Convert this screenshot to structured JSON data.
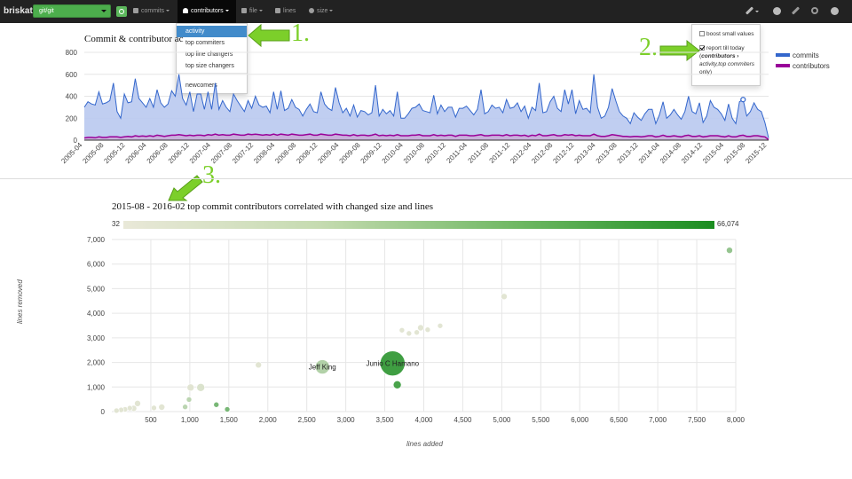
{
  "navbar": {
    "brand": "briskat",
    "repo": "git/git",
    "menus": [
      {
        "label": "commits",
        "icon": "bar-chart-icon"
      },
      {
        "label": "contributors",
        "icon": "user-icon"
      },
      {
        "label": "file",
        "icon": "file-icon"
      },
      {
        "label": "lines",
        "icon": "lines-icon"
      },
      {
        "label": "size",
        "icon": "size-icon"
      }
    ],
    "right_icons": [
      "wrench-icon",
      "plus-circle-icon",
      "pencil-icon",
      "link-icon",
      "help-icon"
    ]
  },
  "contributors_menu": {
    "items": [
      "activity",
      "top commiters",
      "top line changers",
      "top size changers"
    ],
    "extra_item": "newcomers",
    "active_index": 0
  },
  "options_panel": {
    "boost_label": "boost small values",
    "boost_checked": false,
    "report_label_1": "report till today",
    "report_paren_open": "(",
    "report_bold": "contributors",
    "report_arrow": " ›",
    "report_italic": "activity,top commiters",
    "report_paren_close": "only)",
    "report_checked": true
  },
  "annotations": [
    "1.",
    "2.",
    "3."
  ],
  "colors": {
    "accent_green": "#7ccf2a",
    "commits_line": "#3366cc",
    "commits_fill": "#b9c9ef",
    "contributors_line": "#990099",
    "bubble_dark": "#1a8d20",
    "bubble_light": "#e9e8d8"
  },
  "chart_data": [
    {
      "type": "area",
      "title": "Commit & contributor ac",
      "ylim": [
        0,
        800
      ],
      "yticks": [
        "800",
        "600",
        "400",
        "200",
        "0"
      ],
      "x_ticks": [
        "2005-04",
        "2005-08",
        "2005-12",
        "2006-04",
        "2006-08",
        "2006-12",
        "2007-04",
        "2007-08",
        "2007-12",
        "2008-04",
        "2008-08",
        "2008-12",
        "2009-04",
        "2009-08",
        "2009-12",
        "2010-04",
        "2010-08",
        "2010-12",
        "2011-04",
        "2011-08",
        "2011-12",
        "2012-04",
        "2012-08",
        "2012-12",
        "2013-04",
        "2013-08",
        "2013-12",
        "2014-04",
        "2014-08",
        "2014-12",
        "2015-04",
        "2015-08",
        "2015-12"
      ],
      "series": [
        {
          "name": "commits",
          "values": [
            300,
            350,
            330,
            320,
            440,
            330,
            340,
            360,
            520,
            260,
            200,
            420,
            340,
            350,
            560,
            380,
            340,
            300,
            380,
            300,
            460,
            340,
            300,
            330,
            450,
            400,
            600,
            380,
            320,
            440,
            260,
            420,
            420,
            280,
            440,
            280,
            520,
            280,
            360,
            300,
            260,
            420,
            360,
            310,
            260,
            360,
            290,
            400,
            320,
            300,
            310,
            250,
            440,
            280,
            450,
            270,
            290,
            370,
            300,
            280,
            220,
            280,
            330,
            260,
            250,
            440,
            330,
            290,
            270,
            480,
            340,
            250,
            290,
            220,
            320,
            210,
            270,
            260,
            230,
            250,
            500,
            220,
            280,
            240,
            270,
            220,
            440,
            200,
            200,
            240,
            290,
            300,
            330,
            270,
            260,
            250,
            410,
            240,
            320,
            260,
            300,
            300,
            210,
            290,
            290,
            310,
            270,
            230,
            280,
            460,
            240,
            260,
            320,
            290,
            300,
            250,
            370,
            290,
            300,
            340,
            260,
            310,
            200,
            300,
            270,
            520,
            250,
            260,
            350,
            400,
            290,
            260,
            460,
            330,
            460,
            240,
            360,
            280,
            290,
            250,
            600,
            300,
            200,
            220,
            300,
            470,
            360,
            260,
            220,
            200,
            150,
            250,
            210,
            180,
            240,
            280,
            280,
            150,
            230,
            350,
            200,
            230,
            280,
            230,
            190,
            260,
            400,
            260,
            240,
            340,
            160,
            220,
            360,
            300,
            280,
            240,
            180,
            330,
            200,
            150,
            350,
            370,
            220,
            260,
            340,
            280,
            260,
            160,
            20
          ]
        },
        {
          "name": "contributors",
          "values": [
            20,
            25,
            25,
            22,
            30,
            25,
            25,
            30,
            30,
            30,
            25,
            30,
            35,
            30,
            40,
            35,
            38,
            35,
            40,
            35,
            45,
            40,
            35,
            40,
            45,
            45,
            50,
            45,
            40,
            45,
            40,
            45,
            45,
            40,
            50,
            45,
            55,
            45,
            50,
            45,
            45,
            55,
            50,
            45,
            45,
            55,
            50,
            55,
            50,
            45,
            50,
            45,
            55,
            45,
            55,
            50,
            45,
            55,
            50,
            45,
            45,
            50,
            55,
            45,
            45,
            55,
            50,
            45,
            45,
            55,
            50,
            45,
            45,
            40,
            50,
            40,
            45,
            45,
            40,
            45,
            55,
            40,
            45,
            40,
            45,
            40,
            50,
            40,
            40,
            40,
            45,
            45,
            50,
            40,
            40,
            40,
            50,
            40,
            45,
            40,
            45,
            45,
            35,
            45,
            45,
            45,
            40,
            40,
            45,
            50,
            40,
            40,
            45,
            45,
            45,
            40,
            50,
            40,
            45,
            45,
            40,
            45,
            35,
            45,
            40,
            55,
            40,
            40,
            45,
            50,
            40,
            40,
            50,
            45,
            50,
            40,
            45,
            40,
            40,
            40,
            55,
            40,
            35,
            35,
            40,
            50,
            45,
            40,
            35,
            35,
            30,
            35,
            35,
            30,
            35,
            40,
            40,
            30,
            35,
            45,
            35,
            35,
            40,
            35,
            30,
            40,
            45,
            35,
            35,
            40,
            30,
            35,
            40,
            40,
            40,
            35,
            30,
            40,
            30,
            30,
            40,
            45,
            35,
            35,
            40,
            40,
            35,
            30,
            5
          ]
        }
      ],
      "markers": [
        {
          "series": "commits",
          "x_index": 181
        }
      ],
      "legend": [
        "commits",
        "contributors"
      ],
      "legend_position": "right"
    },
    {
      "type": "scatter",
      "title": "2015-08 - 2016-02 top commit contributors correlated with changed size and lines",
      "xlabel": "lines added",
      "ylabel": "lines removed",
      "xlim": [
        0,
        8000
      ],
      "ylim": [
        0,
        7000
      ],
      "xticks": [
        500,
        1000,
        1500,
        2000,
        2500,
        3000,
        3500,
        4000,
        4500,
        5000,
        5500,
        6000,
        6500,
        7000,
        7500,
        8000
      ],
      "yticks": [
        0,
        1000,
        2000,
        3000,
        4000,
        5000,
        6000,
        7000
      ],
      "colorbar": {
        "min": "32",
        "max": "66,074"
      },
      "points": [
        {
          "x": 7920,
          "y": 6560,
          "r": 3.5,
          "c": 0.45
        },
        {
          "x": 5030,
          "y": 4680,
          "r": 3.5,
          "c": 0.05
        },
        {
          "x": 4210,
          "y": 3490,
          "r": 3,
          "c": 0.05
        },
        {
          "x": 4050,
          "y": 3330,
          "r": 3,
          "c": 0.05
        },
        {
          "x": 3960,
          "y": 3410,
          "r": 3.5,
          "c": 0.05
        },
        {
          "x": 3910,
          "y": 3220,
          "r": 3,
          "c": 0.05
        },
        {
          "x": 3810,
          "y": 3180,
          "r": 3,
          "c": 0.05
        },
        {
          "x": 3720,
          "y": 3310,
          "r": 3,
          "c": 0.05
        },
        {
          "x": 3600,
          "y": 1960,
          "r": 14,
          "c": 0.9,
          "label": "Junio C Hamano"
        },
        {
          "x": 3660,
          "y": 1090,
          "r": 4.5,
          "c": 0.85
        },
        {
          "x": 2700,
          "y": 1820,
          "r": 8,
          "c": 0.3,
          "label": "Jeff King"
        },
        {
          "x": 1880,
          "y": 1900,
          "r": 3.5,
          "c": 0.05
        },
        {
          "x": 1480,
          "y": 90,
          "r": 3,
          "c": 0.6
        },
        {
          "x": 1340,
          "y": 280,
          "r": 3,
          "c": 0.6
        },
        {
          "x": 1140,
          "y": 980,
          "r": 4.5,
          "c": 0.08
        },
        {
          "x": 1010,
          "y": 980,
          "r": 4,
          "c": 0.05
        },
        {
          "x": 990,
          "y": 490,
          "r": 3,
          "c": 0.25
        },
        {
          "x": 940,
          "y": 190,
          "r": 3,
          "c": 0.25
        },
        {
          "x": 640,
          "y": 180,
          "r": 3.5,
          "c": 0.05
        },
        {
          "x": 540,
          "y": 150,
          "r": 3,
          "c": 0.05
        },
        {
          "x": 330,
          "y": 330,
          "r": 3.5,
          "c": 0.05
        },
        {
          "x": 280,
          "y": 130,
          "r": 3.5,
          "c": 0.05
        },
        {
          "x": 230,
          "y": 140,
          "r": 3,
          "c": 0.05
        },
        {
          "x": 170,
          "y": 90,
          "r": 3,
          "c": 0.05
        },
        {
          "x": 120,
          "y": 70,
          "r": 3,
          "c": 0.05
        },
        {
          "x": 60,
          "y": 40,
          "r": 3,
          "c": 0.05
        }
      ]
    }
  ]
}
